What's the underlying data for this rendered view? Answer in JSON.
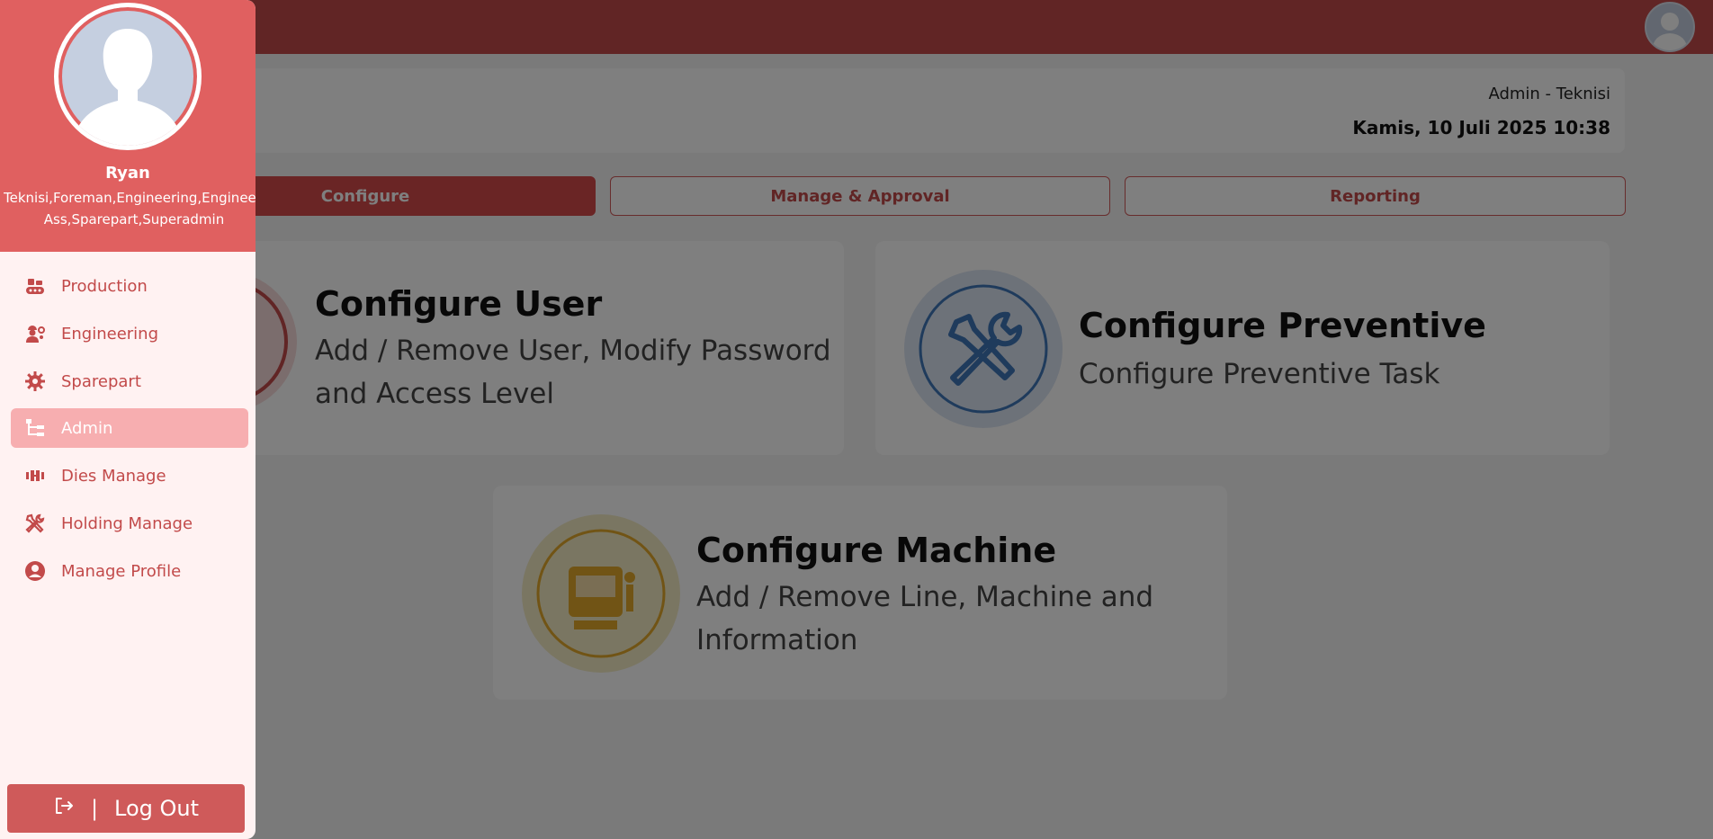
{
  "header": {
    "role": "Admin - Teknisi",
    "datetime": "Kamis, 10 Juli 2025 10:38"
  },
  "tabs": [
    {
      "label": "Configure"
    },
    {
      "label": "Manage & Approval"
    },
    {
      "label": "Reporting"
    }
  ],
  "cards": {
    "user": {
      "title": "Configure User",
      "desc_line1": "Add / Remove User, Modify Password",
      "desc_line2": "and Access Level"
    },
    "preventive": {
      "title": "Configure Preventive",
      "desc": "Configure Preventive Task"
    },
    "machine": {
      "title": "Configure Machine",
      "desc_line1": "Add / Remove Line, Machine and",
      "desc_line2": "Information"
    }
  },
  "sidebar": {
    "user_name": "Ryan",
    "roles_line1": "Teknisi,Foreman,Engineering,Engineering",
    "roles_line2": "Ass,Sparepart,Superadmin",
    "items": [
      {
        "label": "Production",
        "icon": "conveyor-icon"
      },
      {
        "label": "Engineering",
        "icon": "engineer-icon"
      },
      {
        "label": "Sparepart",
        "icon": "gear-icon"
      },
      {
        "label": "Admin",
        "icon": "sitemap-icon"
      },
      {
        "label": "Dies Manage",
        "icon": "dies-icon"
      },
      {
        "label": "Holding Manage",
        "icon": "tools-icon"
      },
      {
        "label": "Manage Profile",
        "icon": "user-circle-icon"
      }
    ],
    "logout": "Log Out"
  },
  "colors": {
    "primary": "#e06060",
    "accent": "#c24a4a",
    "sidebar_bg": "#fff2f2",
    "active_item": "#f7aeb0"
  }
}
